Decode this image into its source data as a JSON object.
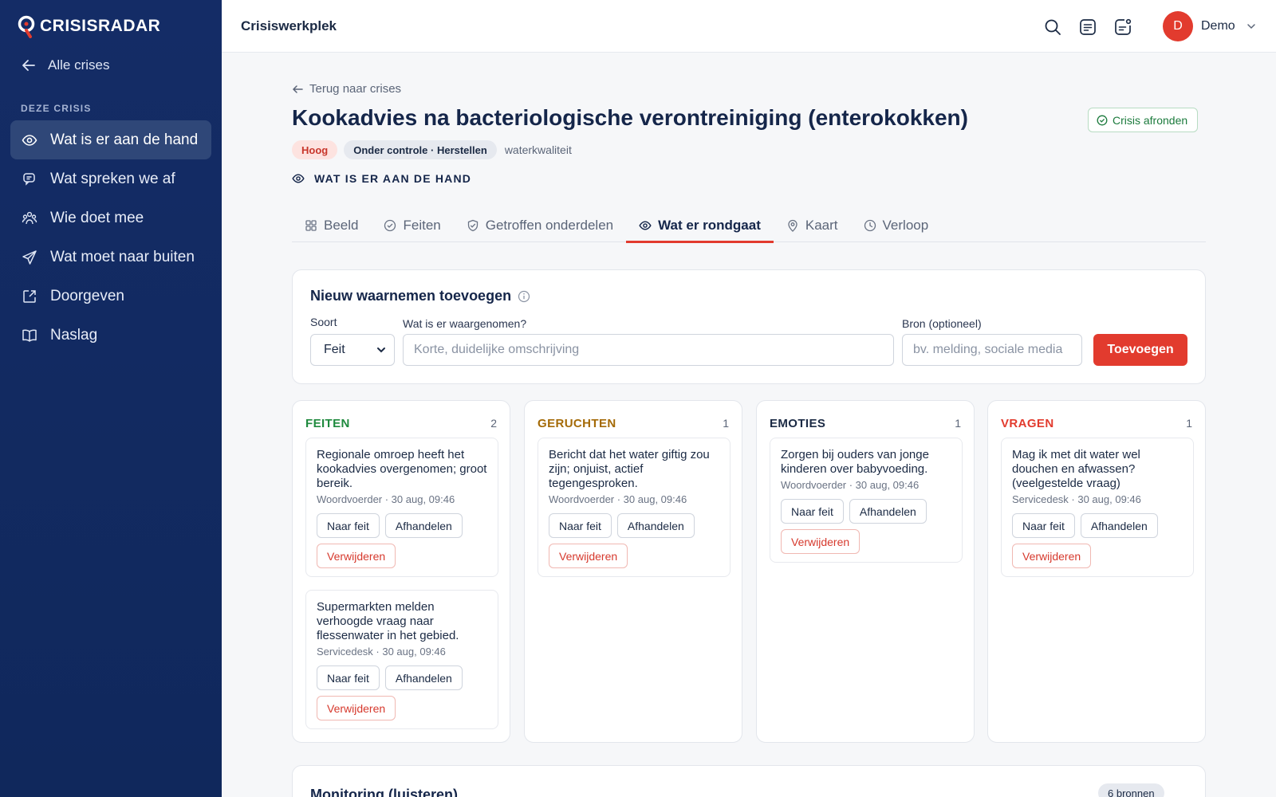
{
  "app": {
    "name": "CRISISRADAR",
    "brand_color": "#e23b2e",
    "sidebar_color": "#142c66"
  },
  "sidebar": {
    "back_label": "Alle crises",
    "section_label": "DEZE CRISIS",
    "items": [
      {
        "label": "Wat is er aan de hand",
        "icon": "eye-icon",
        "active": true
      },
      {
        "label": "Wat spreken we af",
        "icon": "chat-icon",
        "active": false
      },
      {
        "label": "Wie doet mee",
        "icon": "people-icon",
        "active": false
      },
      {
        "label": "Wat moet naar buiten",
        "icon": "send-icon",
        "active": false
      },
      {
        "label": "Doorgeven",
        "icon": "external-link-icon",
        "active": false
      },
      {
        "label": "Naslag",
        "icon": "book-icon",
        "active": false
      }
    ]
  },
  "topbar": {
    "title": "Crisiswerkplek",
    "user_initial": "D",
    "user_name": "Demo"
  },
  "page": {
    "back_link": "Terug naar crises",
    "title": "Kookadvies na bacteriologische verontreiniging (enterokokken)",
    "finish_button": "Crisis afronden",
    "badge_priority": "Hoog",
    "badge_status": "Onder controle · Herstellen",
    "tag": "waterkwaliteit",
    "section_heading": "WAT IS ER AAN DE HAND"
  },
  "tabs": [
    {
      "label": "Beeld",
      "icon": "grid-icon",
      "active": false
    },
    {
      "label": "Feiten",
      "icon": "check-circle-icon",
      "active": false
    },
    {
      "label": "Getroffen onderdelen",
      "icon": "shield-check-icon",
      "active": false
    },
    {
      "label": "Wat er rondgaat",
      "icon": "eye-icon",
      "active": true
    },
    {
      "label": "Kaart",
      "icon": "map-pin-icon",
      "active": false
    },
    {
      "label": "Verloop",
      "icon": "clock-icon",
      "active": false
    }
  ],
  "add_form": {
    "title": "Nieuw waarnemen toevoegen",
    "type_label": "Soort",
    "type_value": "Feit",
    "what_label": "Wat is er waargenomen?",
    "what_placeholder": "Korte, duidelijke omschrijving",
    "source_label": "Bron (optioneel)",
    "source_placeholder": "bv. melding, sociale media",
    "submit_label": "Toevoegen"
  },
  "columns": [
    {
      "title": "FEITEN",
      "count": "2",
      "color": "#1f8a3e",
      "cards": [
        {
          "text": "Regionale omroep heeft het kookadvies overgenomen; groot bereik.",
          "meta": "Woordvoerder · 30 aug, 09:46"
        },
        {
          "text": "Supermarkten melden verhoogde vraag naar flessenwater in het gebied.",
          "meta": "Servicedesk · 30 aug, 09:46"
        }
      ]
    },
    {
      "title": "GERUCHTEN",
      "count": "1",
      "color": "#a46a07",
      "cards": [
        {
          "text": "Bericht dat het water giftig zou zijn; onjuist, actief tegengesproken.",
          "meta": "Woordvoerder · 30 aug, 09:46"
        }
      ]
    },
    {
      "title": "EMOTIES",
      "count": "1",
      "color": "#1b2a44",
      "cards": [
        {
          "text": "Zorgen bij ouders van jonge kinderen over babyvoeding.",
          "meta": "Woordvoerder · 30 aug, 09:46"
        }
      ]
    },
    {
      "title": "VRAGEN",
      "count": "1",
      "color": "#e23b2e",
      "cards": [
        {
          "text": "Mag ik met dit water wel douchen en afwassen? (veelgestelde vraag)",
          "meta": "Servicedesk · 30 aug, 09:46"
        }
      ]
    }
  ],
  "card_actions": {
    "to_fact": "Naar feit",
    "handle": "Afhandelen",
    "delete": "Verwijderen"
  },
  "monitoring": {
    "title": "Monitoring (luisteren)",
    "sources_badge": "6 bronnen"
  }
}
